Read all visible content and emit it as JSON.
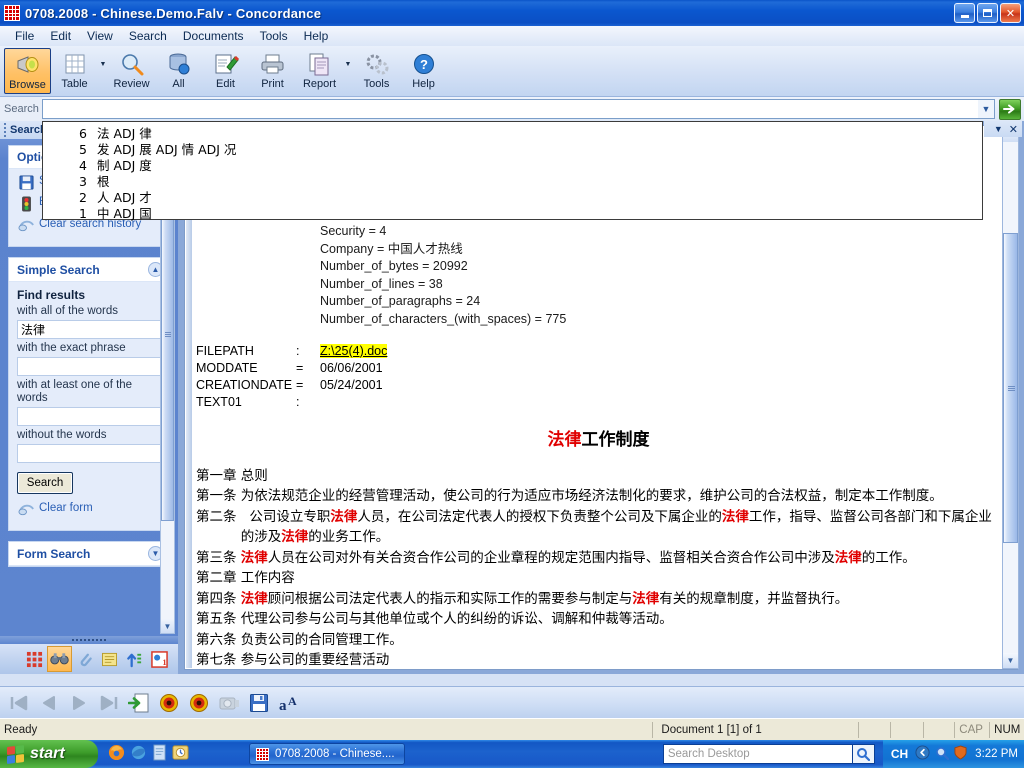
{
  "window": {
    "title": "0708.2008 - Chinese.Demo.Falv - Concordance",
    "minimize_label": "Minimize",
    "maximize_label": "Maximize",
    "close_label": "Close"
  },
  "menu": {
    "items": [
      "File",
      "Edit",
      "View",
      "Search",
      "Documents",
      "Tools",
      "Help"
    ]
  },
  "toolbar": {
    "buttons": [
      {
        "label": "Browse",
        "icon": "flashlight-icon",
        "active": true,
        "dropdown": false
      },
      {
        "label": "Table",
        "icon": "grid-icon",
        "active": false,
        "dropdown": true
      },
      {
        "label": "Review",
        "icon": "magnifier-icon",
        "active": false,
        "dropdown": false
      },
      {
        "label": "All",
        "icon": "database-icon",
        "active": false,
        "dropdown": false
      },
      {
        "label": "Edit",
        "icon": "notepad-pencil-icon",
        "active": false,
        "dropdown": false
      },
      {
        "label": "Print",
        "icon": "printer-icon",
        "active": false,
        "dropdown": false
      },
      {
        "label": "Report",
        "icon": "documents-icon",
        "active": false,
        "dropdown": true
      },
      {
        "label": "Tools",
        "icon": "gears-icon",
        "active": false,
        "dropdown": false
      },
      {
        "label": "Help",
        "icon": "question-circle-icon",
        "active": false,
        "dropdown": false
      }
    ]
  },
  "search_bar": {
    "label": "Search",
    "value": "",
    "placeholder": "",
    "dropdown_icon": "chevron-down-icon",
    "go_icon": "green-arrow-right-icon"
  },
  "search_history": {
    "items": [
      {
        "num": "6",
        "text": "法 ADJ 律"
      },
      {
        "num": "5",
        "text": "发 ADJ 展 ADJ 情 ADJ 况"
      },
      {
        "num": "4",
        "text": "制 ADJ 度"
      },
      {
        "num": "3",
        "text": "根"
      },
      {
        "num": "2",
        "text": "人 ADJ 才"
      },
      {
        "num": "1",
        "text": "中 ADJ 国"
      }
    ]
  },
  "sidebar": {
    "header_title": "Search",
    "options_panel": {
      "title": "Options",
      "items": [
        {
          "label": "Save this query",
          "icon": "save-disk-icon",
          "hidden_behind_dropdown": true
        },
        {
          "label": "Execute a saved query",
          "icon": "traffic-light-icon"
        },
        {
          "label": "Clear search history",
          "icon": "eraser-icon"
        }
      ]
    },
    "simple_search": {
      "title": "Simple Search",
      "collapse_icon": "chevron-up-icon",
      "find_results_label": "Find results",
      "fields": [
        {
          "label": "with all of the words",
          "value": "法律"
        },
        {
          "label": "with the exact phrase",
          "value": ""
        },
        {
          "label": "with at least one of the words",
          "value": ""
        },
        {
          "label": "without the words",
          "value": ""
        }
      ],
      "search_button": "Search",
      "clear_form": "Clear form",
      "clear_form_icon": "eraser-icon"
    },
    "form_search": {
      "title": "Form Search",
      "expand_icon": "chevron-down-icon"
    },
    "bottom_icons": [
      {
        "name": "table-view-icon",
        "active": false
      },
      {
        "name": "browse-binoculars-icon",
        "active": true
      },
      {
        "name": "attachments-paperclip-icon",
        "active": false
      },
      {
        "name": "notes-icon",
        "active": false
      },
      {
        "name": "sort-icon",
        "active": false
      },
      {
        "name": "dictionary-icon",
        "active": false
      }
    ]
  },
  "document": {
    "panel_controls": {
      "dropdown_icon": "chevron-down-icon",
      "close_icon": "close-icon"
    },
    "meta_lines": [
      "Security = 4",
      "Company = 中国人才热线",
      "Number_of_bytes = 20992",
      "Number_of_lines = 38",
      "Number_of_paragraphs = 24",
      "Number_of_characters_(with_spaces) = 775"
    ],
    "fields": [
      {
        "name": "FILEPATH",
        "sep": ":",
        "value": "Z:\\25(4).doc",
        "highlighted": true
      },
      {
        "name": "MODDATE",
        "sep": "=",
        "value": "06/06/2001",
        "highlighted": false
      },
      {
        "name": "CREATIONDATE",
        "sep": "=",
        "value": "05/24/2001",
        "highlighted": false
      },
      {
        "name": "TEXT01",
        "sep": ":",
        "value": "",
        "highlighted": false
      }
    ],
    "title_keyword": "法律",
    "title_rest": "工作制度",
    "keyword": "法律",
    "body": [
      {
        "lead": "第一章 ",
        "parts": [
          {
            "t": "总则",
            "kw": false
          }
        ]
      },
      {
        "lead": "第一条 ",
        "parts": [
          {
            "t": "为依法规范企业的经营管理活动，使公司的行为适应市场经济法制化的要求，维护公司的合法权益，制定本工作制度。",
            "kw": false
          }
        ]
      },
      {
        "lead": "第二条 ",
        "parts": [
          {
            "t": "  公司设立专职",
            "kw": false
          },
          {
            "t": "法律",
            "kw": true
          },
          {
            "t": "人员，在公司法定代表人的授权下负责整个公司及下属企业的",
            "kw": false
          },
          {
            "t": "法律",
            "kw": true
          },
          {
            "t": "工作，指导、监督公司各部门和下属企业的涉及",
            "kw": false
          },
          {
            "t": "法律",
            "kw": true
          },
          {
            "t": "的业务工作。",
            "kw": false
          }
        ]
      },
      {
        "lead": "第三条 ",
        "parts": [
          {
            "t": "法律",
            "kw": true
          },
          {
            "t": "人员在公司对外有关合资合作公司的企业章程的规定范围内指导、监督相关合资合作公司中涉及",
            "kw": false
          },
          {
            "t": "法律",
            "kw": true
          },
          {
            "t": "的工作。",
            "kw": false
          }
        ]
      },
      {
        "lead": "第二章 ",
        "parts": [
          {
            "t": "工作内容",
            "kw": false
          }
        ]
      },
      {
        "lead": "第四条 ",
        "parts": [
          {
            "t": "法律",
            "kw": true
          },
          {
            "t": "顾问根据公司法定代表人的指示和实际工作的需要参与制定与",
            "kw": false
          },
          {
            "t": "法律",
            "kw": true
          },
          {
            "t": "有关的规章制度，并监督执行。",
            "kw": false
          }
        ]
      },
      {
        "lead": "第五条 ",
        "parts": [
          {
            "t": "代理公司参与公司与其他单位或个人的纠纷的诉讼、调解和仲裁等活动。",
            "kw": false
          }
        ]
      },
      {
        "lead": "第六条 ",
        "parts": [
          {
            "t": "负责公司的合同管理工作。",
            "kw": false
          }
        ]
      },
      {
        "lead": "第七条 ",
        "parts": [
          {
            "t": "参与公司的重要经营活动",
            "kw": false
          }
        ]
      }
    ]
  },
  "nav_toolbar": {
    "buttons": [
      {
        "name": "first-record-button",
        "icon": "first-icon",
        "disabled": true
      },
      {
        "name": "previous-record-button",
        "icon": "previous-icon",
        "disabled": true
      },
      {
        "name": "next-record-button",
        "icon": "next-icon",
        "disabled": true
      },
      {
        "name": "last-record-button",
        "icon": "last-icon",
        "disabled": true
      },
      {
        "name": "goto-record-button",
        "icon": "goto-doc-icon",
        "disabled": false
      },
      {
        "name": "mark-record-button",
        "icon": "red-target-icon",
        "disabled": false
      },
      {
        "name": "unmark-record-button",
        "icon": "red-target-icon",
        "disabled": false
      },
      {
        "name": "camera-button",
        "icon": "camera-icon",
        "disabled": true
      },
      {
        "name": "save-button",
        "icon": "floppy-disk-icon",
        "disabled": false
      },
      {
        "name": "font-button",
        "icon": "font-aA-icon",
        "disabled": false
      }
    ]
  },
  "status_bar": {
    "message": "Ready",
    "document_info": "Document 1 [1] of 1",
    "caps": "CAP",
    "num": "NUM"
  },
  "taskbar": {
    "start_label": "start",
    "quick_launch": [
      {
        "name": "firefox-icon"
      },
      {
        "name": "internet-explorer-icon"
      },
      {
        "name": "notepad-icon"
      },
      {
        "name": "outlook-icon"
      }
    ],
    "tasks": [
      {
        "label": "0708.2008 - Chinese....",
        "icon": "concordance-icon",
        "active": true
      }
    ],
    "desktop_search": {
      "placeholder": "Search Desktop",
      "value": "",
      "icon": "magnifier-icon"
    },
    "tray": {
      "language": "CH",
      "icons": [
        "show-hidden-icon",
        "magnifier-icon",
        "shield-icon"
      ],
      "clock": "3:22 PM"
    }
  },
  "colors": {
    "title_blue": "#0b57cf",
    "keyword_red": "#e00000",
    "highlight_yellow": "#ffff00",
    "sidebar_blue": "#5d85cf",
    "panel_light": "#e4ecfa",
    "status_bg": "#ece9d8",
    "active_orange": "#ffb84d",
    "go_green": "#3f9c23"
  }
}
